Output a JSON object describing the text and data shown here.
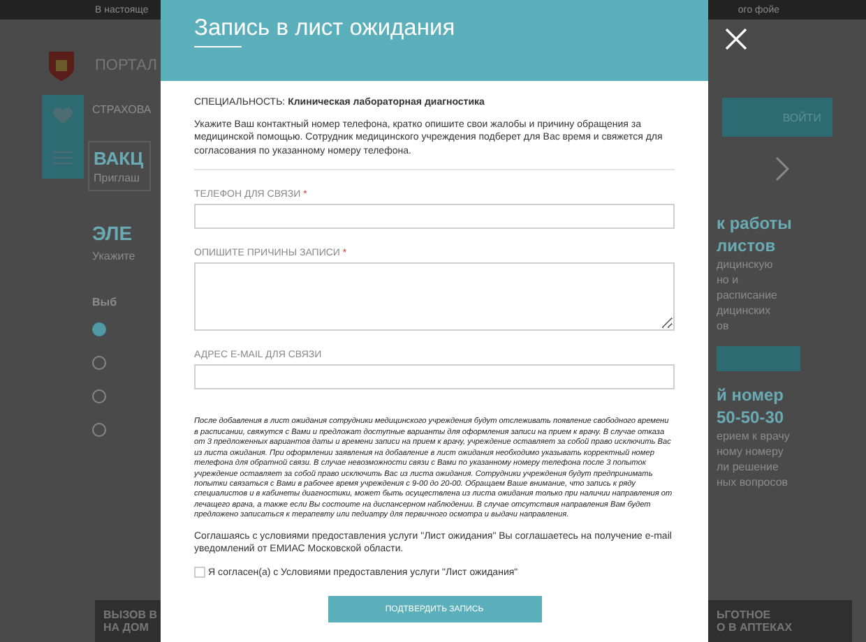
{
  "background_page": {
    "top_bar": [
      "В настояще",
      "ого фойе"
    ],
    "left": {
      "portal": "ПОРТАЛ",
      "menu_item": "СТРАХОВА",
      "banner_title": "ВАКЦ",
      "banner_text": "Приглаш",
      "section_title": "ЭЛЕ",
      "section_text": "Укажите",
      "choice_label": "Выб",
      "options": [
        {
          "selected": true
        },
        {
          "selected": false
        },
        {
          "selected": false
        },
        {
          "selected": false
        }
      ],
      "tile_lines": [
        "ВЫЗОВ В",
        "НА ДОМ"
      ]
    },
    "right": {
      "login_button": "ВОЙТИ",
      "heading_lines": [
        "к работы",
        "листов"
      ],
      "text_lines": [
        "дицинскую",
        "но и",
        "расписание",
        "дицинских",
        "ов"
      ],
      "phone_heading": "й номер",
      "phone": "50-50-30",
      "phone_lines": [
        "ерием к врачу",
        "ному номеру",
        "ли решение",
        "ных вопросов"
      ],
      "tile_lines": [
        "ЬГОТНОЕ",
        "О В АПТЕКАХ"
      ]
    }
  },
  "modal": {
    "title": "Запись в лист ожидания",
    "specialty": "СПЕЦИАЛЬНОСТЬ: **Клиническая лабораторная диагностика**",
    "intro": "Укажите Ваш контактный номер телефона, кратко опишите свои жалобы и причину обращения за медицинской помощью. Сотрудник медицинского учреждения подберет для Вас время и свяжется для согласования по указанному номеру телефона.",
    "fields": [
      {
        "kind": "input",
        "label": "ТЕЛЕФОН ДЛЯ СВЯЗИ",
        "required_mark": "*"
      },
      {
        "kind": "textarea",
        "label": "ОПИШИТЕ ПРИЧИНЫ ЗАПИСИ",
        "required_mark": "*"
      },
      {
        "kind": "input",
        "label": "АДРЕС E-MAIL ДЛЯ СВЯЗИ"
      }
    ],
    "notice": "После добавления в лист ожидания сотрудники медицинского учреждения будут отслеживать появление свободного времени в расписании, свяжутся с Вами и предложат доступные варианты для оформления записи на прием к врачу. В случае отказа от 3 предложенных вариантов даты и времени записи на прием к врачу, учреждение оставляет за собой право исключить Вас из листа ожидания. При оформлении заявления на добавление в лист ожидания необходимо указывать корректный номер телефона для обратной связи. В случае невозможности связи с Вами по указанному номеру телефона после 3 попыток учреждение оставляет за собой право исключить Вас из листа ожидания. Сотрудники учреждения будут предпринимать попытки связаться с Вами в рабочее время учреждения с 9-00 до 20-00. Обращаем Ваше внимание, что запись к ряду специалистов и в кабинеты диагностики, может быть осуществлена из листа ожидания только при наличии направления от лечащего врача, а также если Вы состоите на диспансерном наблюдении. В случае отсутствия направления Вам будет предложено записаться к терапевту или педиатру для первичного осмотра и выдачи направления.",
    "consent_text": "Соглашаясь с условиями предоставления услуги \"Лист ожидания\" Вы соглашаетесь на получение e-mail уведомлений от ЕМИАС Московской области.",
    "agreement": {
      "label": "Я согласен(а) с Условиями предоставления услуги \"Лист ожидания\"",
      "checked": false
    },
    "submit_button": "ПОДТВЕРДИТЬ ЗАПИСЬ"
  }
}
